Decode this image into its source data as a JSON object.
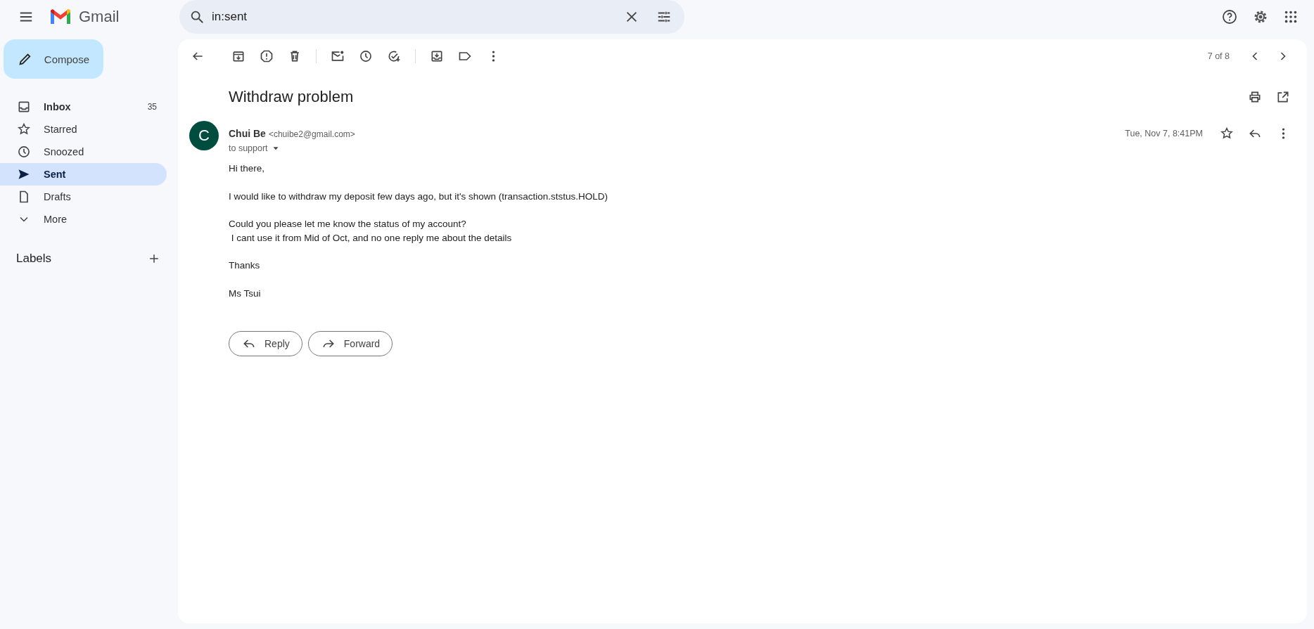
{
  "app": {
    "name": "Gmail"
  },
  "search": {
    "value": "in:sent"
  },
  "compose": {
    "label": "Compose"
  },
  "sidebar": {
    "items": [
      {
        "label": "Inbox",
        "count": "35",
        "unread": true,
        "selected": false
      },
      {
        "label": "Starred",
        "unread": false,
        "selected": false
      },
      {
        "label": "Snoozed",
        "unread": false,
        "selected": false
      },
      {
        "label": "Sent",
        "unread": false,
        "selected": true
      },
      {
        "label": "Drafts",
        "unread": false,
        "selected": false
      },
      {
        "label": "More",
        "unread": false,
        "selected": false
      }
    ],
    "labels_heading": "Labels"
  },
  "toolbar": {
    "position": "7 of 8"
  },
  "message": {
    "subject": "Withdraw problem",
    "sender": {
      "initial": "C",
      "name": "Chui Be",
      "email": "<chuibe2@gmail.com>",
      "recipients": "to support"
    },
    "date": "Tue, Nov 7, 8:41PM",
    "starred": false,
    "body": [
      "Hi there,",
      "I would like to withdraw my deposit few days ago, but it's shown (transaction.ststus.HOLD)",
      "Could you please let me know the status of my account?\n I cant use it from Mid of Oct, and no one reply me about the details",
      "Thanks",
      "Ms Tsui"
    ],
    "actions": [
      {
        "kind": "reply",
        "label": "Reply"
      },
      {
        "kind": "forward",
        "label": "Forward"
      }
    ]
  }
}
